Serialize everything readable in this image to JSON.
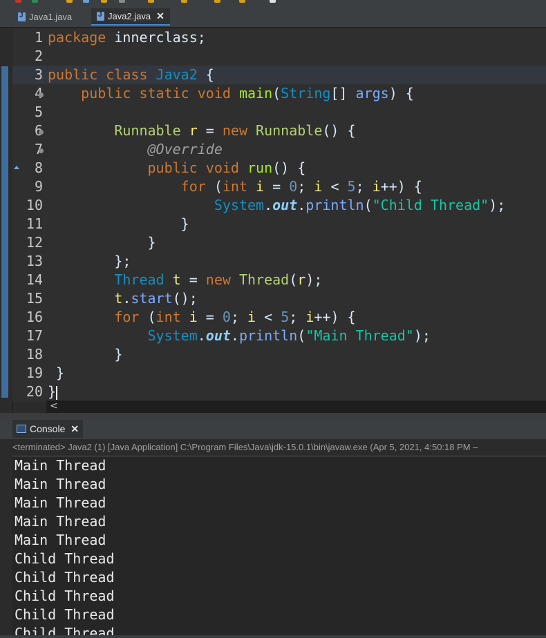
{
  "colors": {
    "accent": "#4a88c7",
    "editor_bg": "#2f2f2f",
    "keyword": "#cc7832",
    "string": "#17c6a3"
  },
  "tabs": [
    {
      "label": "Java1.java",
      "active": false
    },
    {
      "label": "Java2.java",
      "active": true
    }
  ],
  "editor": {
    "lines": [
      {
        "num": "1",
        "text": "package innerclass;"
      },
      {
        "num": "2",
        "text": ""
      },
      {
        "num": "3",
        "text": "public class Java2 {"
      },
      {
        "num": "4",
        "text": "    public static void main(String[] args) {"
      },
      {
        "num": "5",
        "text": ""
      },
      {
        "num": "6",
        "text": "        Runnable r = new Runnable() {"
      },
      {
        "num": "7",
        "text": "            @Override"
      },
      {
        "num": "8",
        "text": "            public void run() {"
      },
      {
        "num": "9",
        "text": "                for (int i = 0; i < 5; i++) {"
      },
      {
        "num": "10",
        "text": "                    System.out.println(\"Child Thread\");"
      },
      {
        "num": "11",
        "text": "                }"
      },
      {
        "num": "12",
        "text": "            }"
      },
      {
        "num": "13",
        "text": "        };"
      },
      {
        "num": "14",
        "text": "        Thread t = new Thread(r);"
      },
      {
        "num": "15",
        "text": "        t.start();"
      },
      {
        "num": "16",
        "text": "        for (int i = 0; i < 5; i++) {"
      },
      {
        "num": "17",
        "text": "            System.out.println(\"Main Thread\");"
      },
      {
        "num": "18",
        "text": "        }"
      },
      {
        "num": "19",
        "text": "}"
      },
      {
        "num": "20",
        "text": "}"
      }
    ]
  },
  "scrollbar": {
    "left_arrow": "<"
  },
  "console": {
    "tab_label": "Console",
    "status": "<terminated> Java2 (1) [Java Application] C:\\Program Files\\Java\\jdk-15.0.1\\bin\\javaw.exe  (Apr 5, 2021, 4:50:18 PM –",
    "output": [
      "Main Thread",
      "Main Thread",
      "Main Thread",
      "Main Thread",
      "Main Thread",
      "Child Thread",
      "Child Thread",
      "Child Thread",
      "Child Thread",
      "Child Thread"
    ]
  },
  "icons": {
    "tab_file": "java-file-icon",
    "close": "close-icon",
    "console": "console-icon"
  }
}
